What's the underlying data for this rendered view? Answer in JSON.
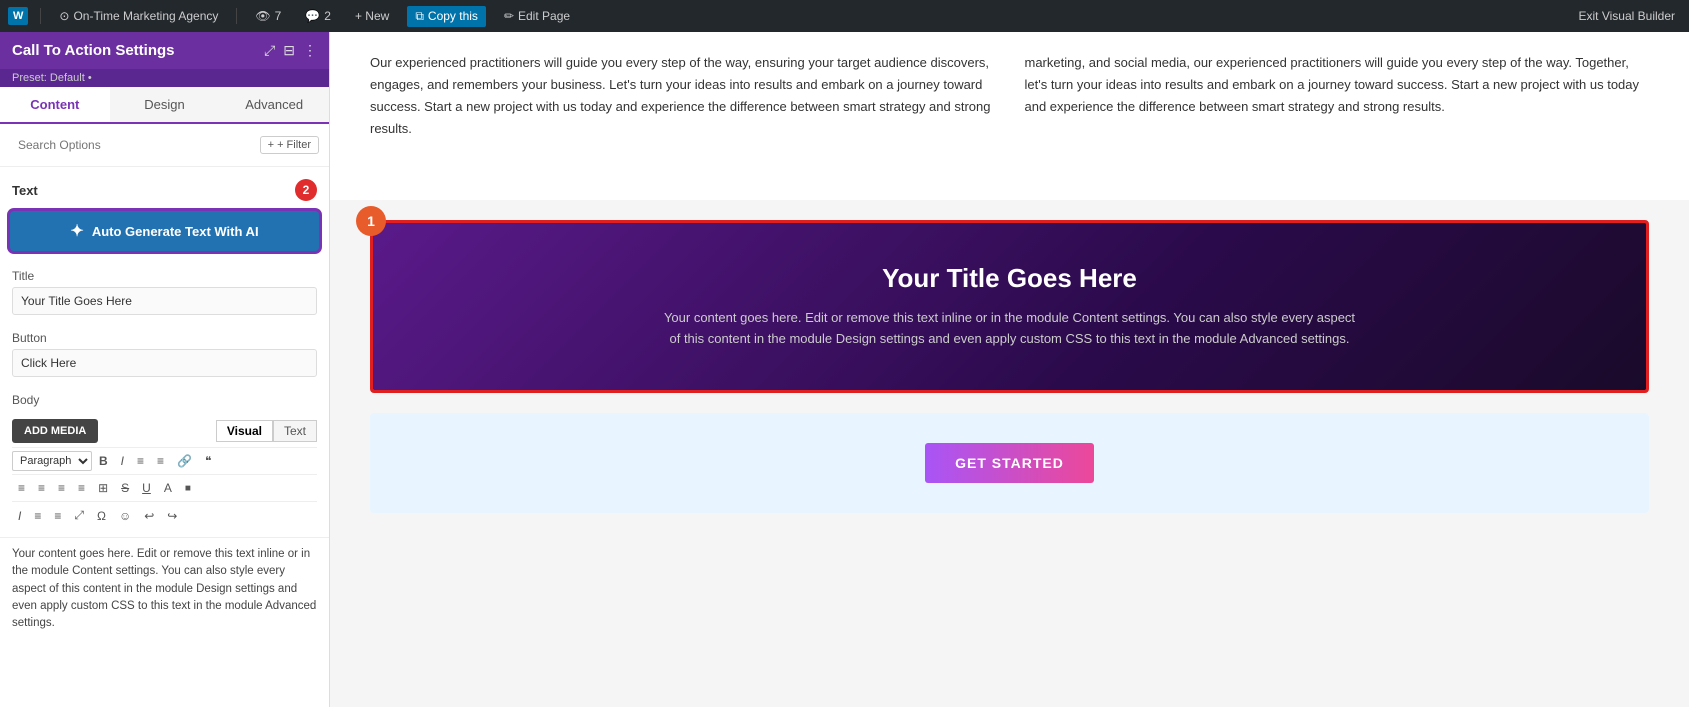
{
  "topbar": {
    "wp_logo": "W",
    "site_name": "On-Time Marketing Agency",
    "views": "7",
    "comments": "2",
    "new_label": "+ New",
    "copy_label": "Copy this",
    "edit_label": "Edit Page",
    "exit_label": "Exit Visual Builder"
  },
  "sidebar": {
    "title": "Call To Action Settings",
    "preset": "Preset: Default •",
    "tabs": [
      "Content",
      "Design",
      "Advanced"
    ],
    "active_tab": "Content",
    "search_placeholder": "Search Options",
    "filter_label": "+ Filter",
    "text_section_label": "Text",
    "text_badge": "2",
    "ai_button_label": "Auto Generate Text With AI",
    "title_label": "Title",
    "title_value": "Your Title Goes Here",
    "button_label": "Button",
    "button_value": "Click Here",
    "body_label": "Body",
    "add_media_label": "ADD MEDIA",
    "visual_tab": "Visual",
    "text_tab": "Text",
    "paragraph_select": "Paragraph",
    "toolbar_icons": [
      "B",
      "I",
      "≡",
      "≡",
      "🔗",
      "❝",
      "≡",
      "≡",
      "≡",
      "≡",
      "⊞",
      "S",
      "U",
      "A",
      "■",
      "I",
      "≡",
      "≡",
      "⤢",
      "Ω",
      "☺",
      "↩",
      "↪"
    ],
    "body_content": "Your content goes here. Edit or remove this text inline or in the module Content settings. You can also style every aspect of this content in the module Design settings and even apply custom CSS to this text in the module Advanced settings."
  },
  "main": {
    "col1_p1": "Our experienced practitioners will guide you every step of the way, ensuring your target audience discovers, engages, and remembers your business. Let's turn your ideas into results and embark on a journey toward success. Start a new project with us today and experience the difference between smart strategy and strong results.",
    "col2_p1": "marketing, and social media, our experienced practitioners will guide you every step of the way. Together, let's turn your ideas into results and embark on a journey toward success. Start a new project with us today and experience the difference between smart strategy and strong results.",
    "cta_badge": "1",
    "cta_title": "Your Title Goes Here",
    "cta_body": "Your content goes here. Edit or remove this text inline or in the module Content settings. You can also style every aspect of this content in the module Design settings and even apply custom CSS to this text in the module Advanced settings.",
    "get_started_label": "GET STARTED"
  },
  "colors": {
    "sidebar_bg": "#6b2fa0",
    "tab_active": "#7b33b5",
    "cta_border": "#e02020",
    "badge_bg": "#e02c2c"
  }
}
